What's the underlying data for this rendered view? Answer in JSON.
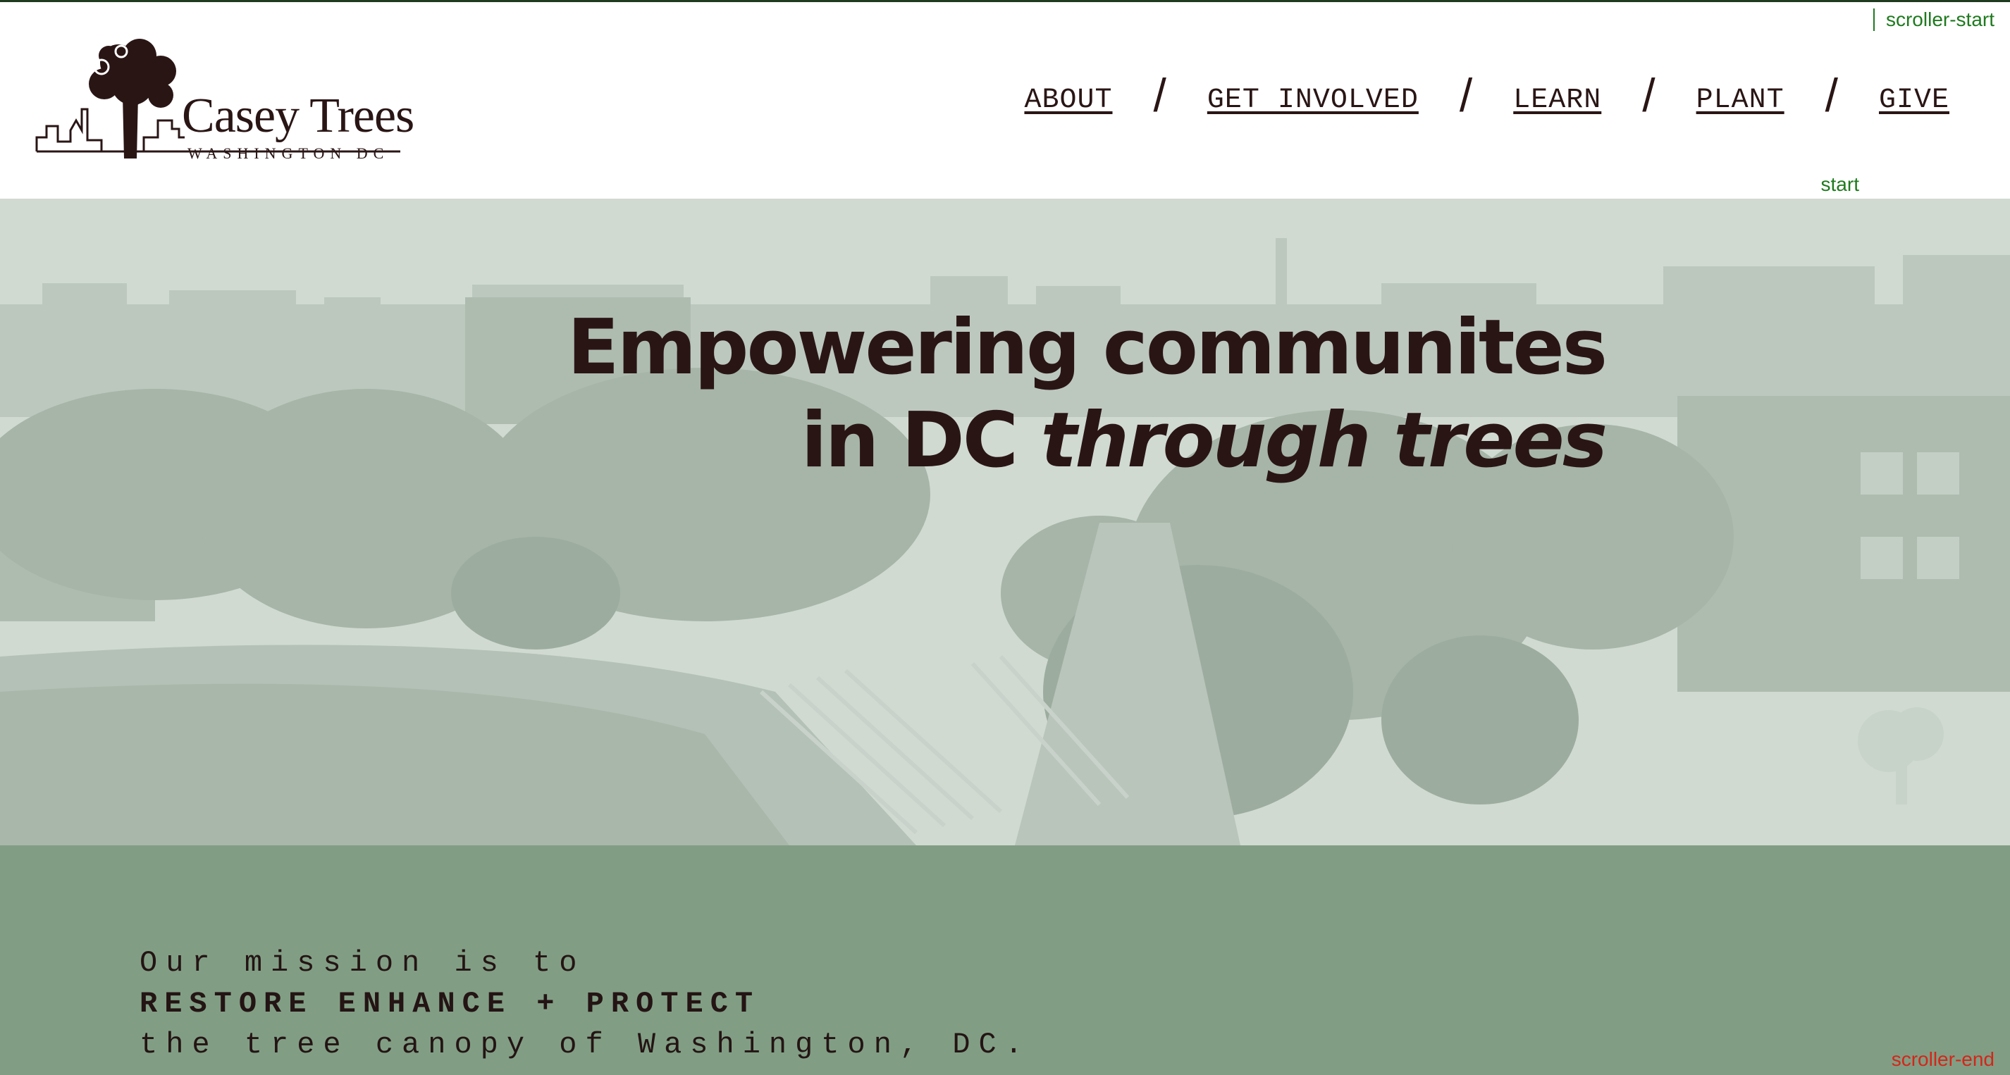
{
  "brand": {
    "name": "Casey Trees",
    "subtitle": "WASHINGTON DC"
  },
  "nav": {
    "items": [
      {
        "label": "ABOUT"
      },
      {
        "label": "GET INVOLVED"
      },
      {
        "label": "LEARN"
      },
      {
        "label": "PLANT"
      },
      {
        "label": "GIVE"
      }
    ],
    "separator": "/"
  },
  "debug_markers": {
    "scroller_start": "scroller-start",
    "start": "start",
    "scroller_end": "scroller-end"
  },
  "hero": {
    "line1": "Empowering communites",
    "line2_plain": "in DC ",
    "line2_italic": "through trees"
  },
  "mission": {
    "line1": "Our mission is to",
    "line2": "RESTORE ENHANCE + PROTECT",
    "line3": "the tree canopy of Washington, DC."
  },
  "colors": {
    "text_dark": "#2a1515",
    "hero_bg": "#cdd7ce",
    "mission_bg": "#819e84",
    "marker_green": "#1f7a1f",
    "marker_red": "#d4261a"
  }
}
